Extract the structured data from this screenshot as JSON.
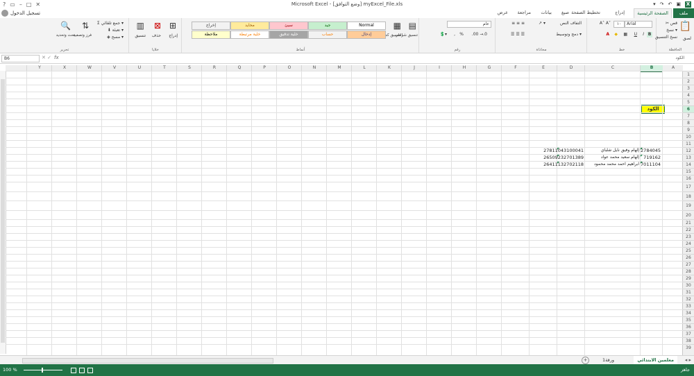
{
  "titlebar": {
    "title": "Microsoft Excel",
    "file": "myExcel_File.xls",
    "mode": "[وضع التوافق]",
    "qa": [
      "↶",
      "↷",
      "▾"
    ],
    "window": [
      "–",
      "□",
      "✕",
      "?"
    ]
  },
  "account": {
    "signin": "تسجيل الدخول"
  },
  "tabs": {
    "file": "ملف",
    "active": "الصفحة الرئيسية",
    "items": [
      "إدراج",
      "تخطيط الصفحة",
      "صيغ",
      "بيانات",
      "مراجعة",
      "عرض"
    ]
  },
  "ribbon": {
    "clipboard": {
      "label": "الحافظة",
      "paste": "لصق",
      "cut": "قص",
      "copy": "نسخ ▾",
      "format": "نسخ التنسيق"
    },
    "font": {
      "label": "خط",
      "name": "Arial",
      "size": "١٠",
      "bold": "B",
      "italic": "I",
      "underline": "U"
    },
    "alignment": {
      "label": "محاذاة",
      "wrap": "التفاف النص",
      "merge": "دمج وتوسيط ▾"
    },
    "number": {
      "label": "رقم",
      "format": "عام",
      "pct": "%",
      "comma": ","
    },
    "styles": {
      "label": "أنماط",
      "conditional": "تنسيق شرطي",
      "table": "التنسيق كجدول",
      "cells": [
        {
          "text": "Normal",
          "bg": "#ffffff",
          "fg": "#000000"
        },
        {
          "text": "جيد",
          "bg": "#c6efce",
          "fg": "#006100"
        },
        {
          "text": "سيئ",
          "bg": "#ffc7ce",
          "fg": "#9c0006"
        },
        {
          "text": "محايد",
          "bg": "#ffeb9c",
          "fg": "#9c5700"
        },
        {
          "text": "إخراج",
          "bg": "#f2f2f2",
          "fg": "#3f3f3f"
        },
        {
          "text": "إدخال",
          "bg": "#ffcc99",
          "fg": "#3f3f76"
        },
        {
          "text": "حساب",
          "bg": "#f2f2f2",
          "fg": "#fa7d00"
        },
        {
          "text": "خلية تدقيق",
          "bg": "#a5a5a5",
          "fg": "#ffffff"
        },
        {
          "text": "خلية مرتبطة",
          "bg": "#ffffff",
          "fg": "#fa7d00"
        },
        {
          "text": "ملاحظة",
          "bg": "#ffffcc",
          "fg": "#000000"
        }
      ]
    },
    "cells": {
      "label": "خلايا",
      "insert": "إدراج",
      "delete": "حذف",
      "format": "تنسيق"
    },
    "editing": {
      "label": "تحرير",
      "sum": "جمع تلقائي ▾",
      "fill": "تعبئة ▾",
      "clear": "مسح ▾",
      "sort": "فرز وتصفية",
      "find": "بحث وتحديد"
    }
  },
  "formula": {
    "namebox": "B6",
    "fx": "fx",
    "content": "",
    "right": "الكود"
  },
  "columns": [
    "A",
    "B",
    "C",
    "D",
    "E",
    "F",
    "G",
    "H",
    "I",
    "J",
    "K",
    "L",
    "M",
    "N",
    "O",
    "P",
    "Q",
    "R",
    "S",
    "T",
    "U",
    "V",
    "W",
    "X",
    "Y"
  ],
  "selected_col": "B",
  "selected_row": 6,
  "rows": [
    1,
    2,
    3,
    4,
    5,
    6,
    7,
    8,
    9,
    10,
    11,
    12,
    13,
    14,
    15,
    16,
    17,
    18,
    19,
    20,
    21,
    22,
    23,
    24,
    25,
    26,
    27,
    28,
    29,
    30,
    31,
    32,
    33,
    34,
    35,
    36,
    37,
    38,
    39
  ],
  "cell_code": "الكود",
  "records": [
    {
      "code": "2784045",
      "name": "إلهام وفيق نايل شلباي",
      "id": "27811043100041"
    },
    {
      "code": "719162",
      "name": "إلهام سعيد محمد عواد",
      "id": "26509232701389"
    },
    {
      "code": "7011104",
      "name": "ابراهيم احمد محمد محمود",
      "id": "26411132702118"
    }
  ],
  "sheets": [
    "معلمين الابتدائي",
    "ورقة1"
  ],
  "status": {
    "ready": "جاهز",
    "zoom": "100 %"
  }
}
